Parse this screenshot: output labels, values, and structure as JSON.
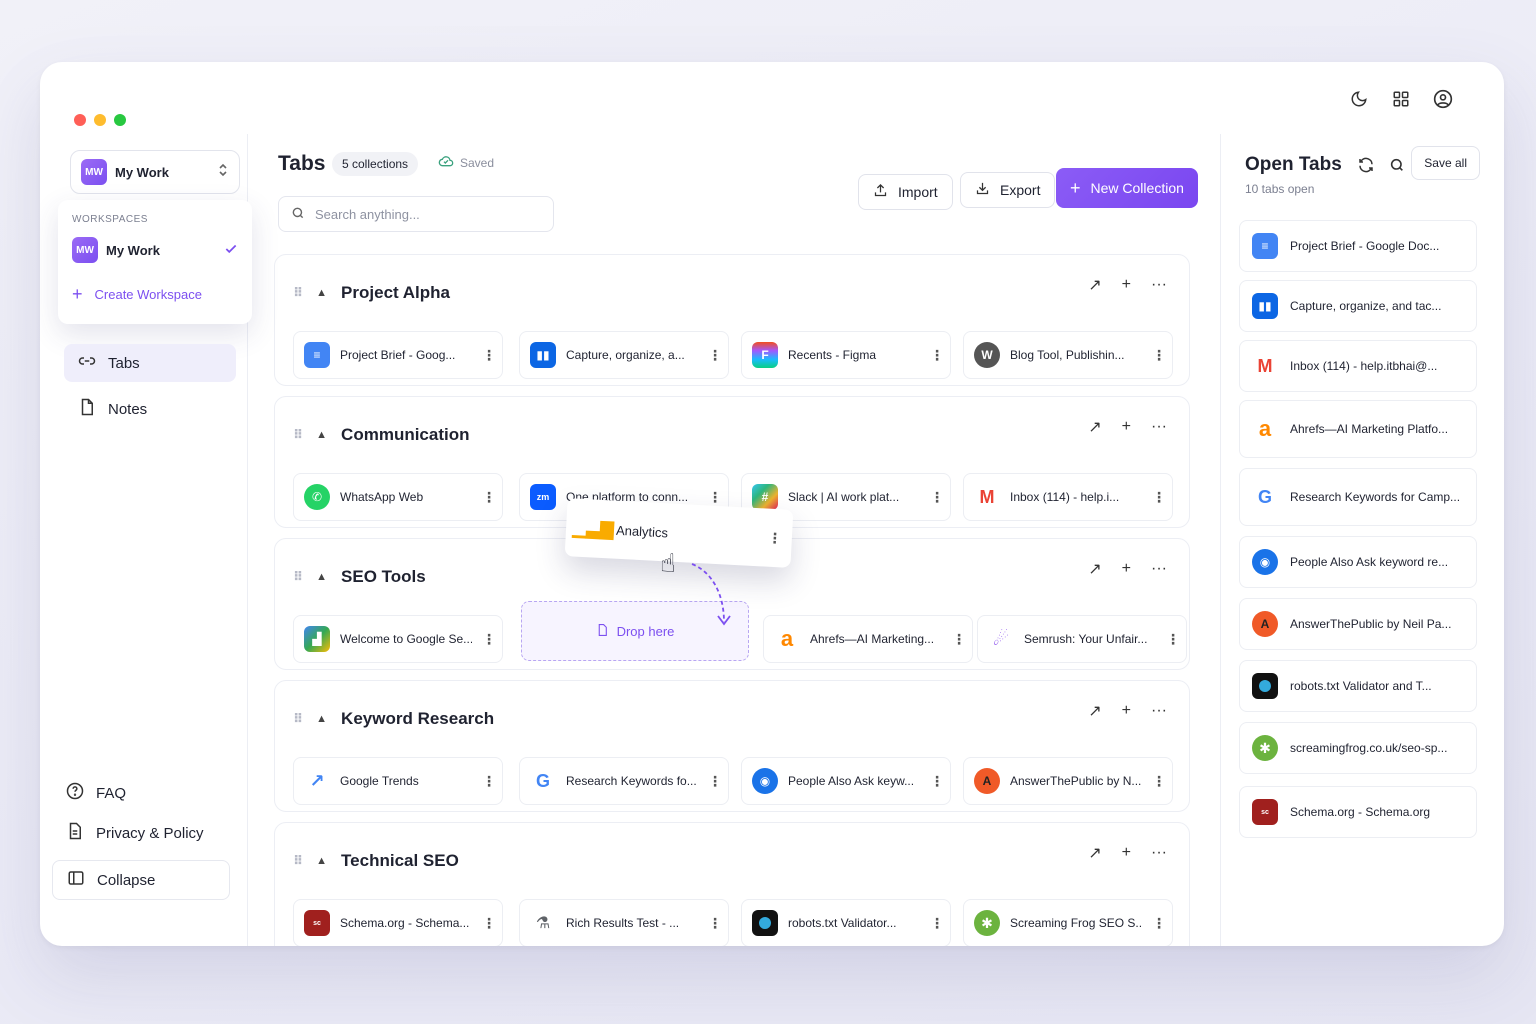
{
  "window": {
    "dots": [
      "#ff5f57",
      "#febc2e",
      "#28c840"
    ],
    "toolbar_icons": [
      "moon-icon",
      "grid-icon",
      "user-circle-icon"
    ]
  },
  "sidebar": {
    "workspace": {
      "avatar": "MW",
      "name": "My Work"
    },
    "popover": {
      "heading": "WORKSPACES",
      "item_avatar": "MW",
      "item_name": "My Work",
      "create_label": "Create Workspace"
    },
    "nav": [
      {
        "label": "Tabs",
        "icon": "link-icon",
        "active": true
      },
      {
        "label": "Notes",
        "icon": "file-icon",
        "active": false
      }
    ],
    "footer": [
      {
        "label": "FAQ",
        "icon": "help-circle-icon"
      },
      {
        "label": "Privacy & Policy",
        "icon": "document-icon"
      }
    ],
    "collapse_label": "Collapse"
  },
  "main": {
    "title": "Tabs",
    "collections_badge": "5 collections",
    "saved_label": "Saved",
    "search_placeholder": "Search anything...",
    "import_label": "Import",
    "export_label": "Export",
    "new_collection_label": "New Collection",
    "drop_label": "Drop here",
    "dragging_card": "Analytics",
    "collections": [
      {
        "name": "Project Alpha",
        "tabs": [
          "Project Brief - Goog...",
          "Capture, organize, a...",
          "Recents - Figma",
          "Blog Tool, Publishin..."
        ]
      },
      {
        "name": "Communication",
        "tabs": [
          "WhatsApp Web",
          "One platform to conn...",
          "Slack | AI work plat...",
          "Inbox (114) - help.i..."
        ]
      },
      {
        "name": "SEO Tools",
        "tabs": [
          "Welcome to Google Se...",
          "Ahrefs—AI Marketing...",
          "Semrush: Your Unfair..."
        ]
      },
      {
        "name": "Keyword Research",
        "tabs": [
          "Google Trends",
          "Research Keywords fo...",
          "People Also Ask keyw...",
          "AnswerThePublic by N..."
        ]
      },
      {
        "name": "Technical SEO",
        "tabs": [
          "Schema.org - Schema...",
          "Rich Results Test - ...",
          "robots.txt Validator...",
          "Screaming Frog SEO S..."
        ]
      }
    ]
  },
  "open_tabs": {
    "title": "Open Tabs",
    "subtitle": "10 tabs open",
    "save_all_label": "Save all",
    "items": [
      "Project Brief - Google Doc...",
      "Capture, organize, and tac...",
      "Inbox (114) - help.itbhai@...",
      "Ahrefs—AI Marketing Platfo...",
      "Research Keywords for Camp...",
      "People Also Ask keyword re...",
      "AnswerThePublic by Neil Pa...",
      "robots.txt Validator and T...",
      "screamingfrog.co.uk/seo-sp...",
      "Schema.org - Schema.org"
    ]
  },
  "colors": {
    "accent": "#7c4ff0",
    "brand_gradient_start": "#8b5cf6"
  }
}
